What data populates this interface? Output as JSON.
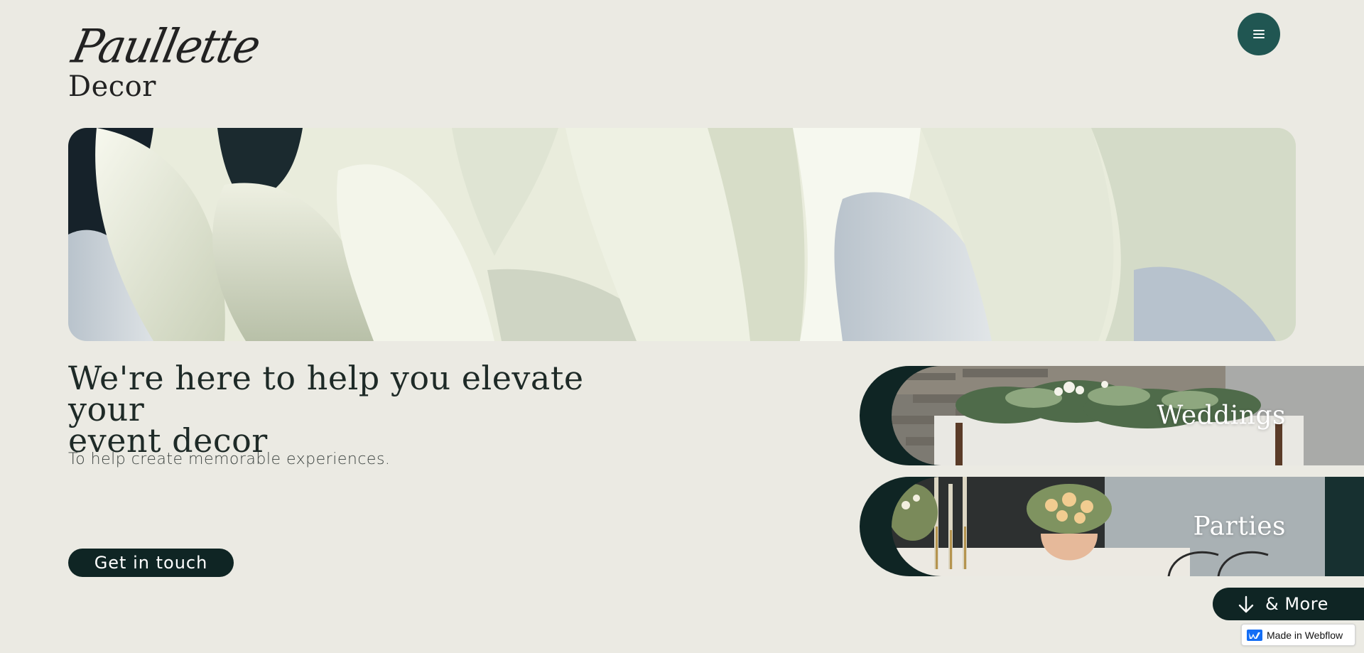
{
  "brand": {
    "script_name": "Paullette",
    "word_name": "Decor"
  },
  "menu": {
    "icon": "hamburger-icon"
  },
  "hero": {
    "image_subject": "white-tulip-petals"
  },
  "intro": {
    "headline_line1": "We're here to help you elevate your",
    "headline_line2": "event decor",
    "subline": "To help create memorable experiences.",
    "cta_label": "Get in touch"
  },
  "categories": [
    {
      "label": "Weddings"
    },
    {
      "label": "Parties"
    }
  ],
  "more": {
    "label": "& More",
    "icon": "arrow-down-icon"
  },
  "badge": {
    "label": "Made in Webflow",
    "icon": "webflow-logo-icon"
  },
  "colors": {
    "background": "#EBEAE3",
    "dark_green": "#0F2524",
    "accent_teal": "#205652",
    "text": "#1E2A27"
  }
}
